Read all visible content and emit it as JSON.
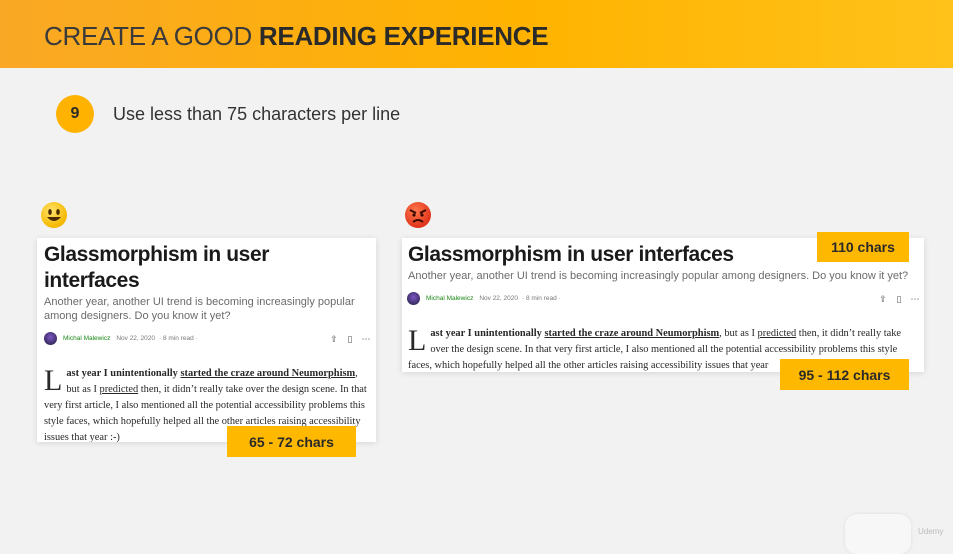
{
  "header": {
    "title_plain": "CREATE A GOOD ",
    "title_bold": "READING EXPERIENCE"
  },
  "step": {
    "number": "9",
    "text": "Use less than 75 characters per line"
  },
  "icons": {
    "good": "smiling-face-icon",
    "bad": "angry-face-icon"
  },
  "colors": {
    "accent": "#ffb300",
    "good_emoji": "#f5b800",
    "bad_emoji": "#e0341c"
  },
  "left_article": {
    "title": "Glassmorphism in user interfaces",
    "subtitle": "Another year, another UI trend is becoming increasingly popular among designers. Do you know it yet?",
    "author": "Michal Malewicz",
    "date": "Nov 22, 2020",
    "read_time": "· 8 min read ·",
    "dropcap": "L",
    "body_lead": "ast year I unintentionally ",
    "body_link1": "started the craze around Neumorphism",
    "body_mid1": ", but as I ",
    "body_link2": "predicted",
    "body_rest": " then, it didn’t really take over the design scene. In that very first article, I also mentioned all the potential accessibility problems this style faces, which hopefully helped all the other articles raising accessibility issues that year :-)"
  },
  "right_article": {
    "title": "Glassmorphism in user interfaces",
    "subtitle": "Another year, another UI trend is becoming increasingly popular among designers. Do you know it yet?",
    "author": "Michal Malewicz",
    "date": "Nov 22, 2020",
    "read_time": "· 8 min read ·",
    "dropcap": "L",
    "body_lead": "ast year I unintentionally ",
    "body_link1": "started the craze around Neumorphism",
    "body_mid1": ", but as I ",
    "body_link2": "predicted",
    "body_rest": " then, it didn’t really take over the design scene. In that very first article, I also mentioned all the potential accessibility problems this style faces, which hopefully helped all the other articles raising accessibility issues that year"
  },
  "badges": {
    "left": "65 - 72 chars",
    "right_top": "110 chars",
    "right_bottom": "95 - 112 chars"
  },
  "watermark": "Udemy"
}
